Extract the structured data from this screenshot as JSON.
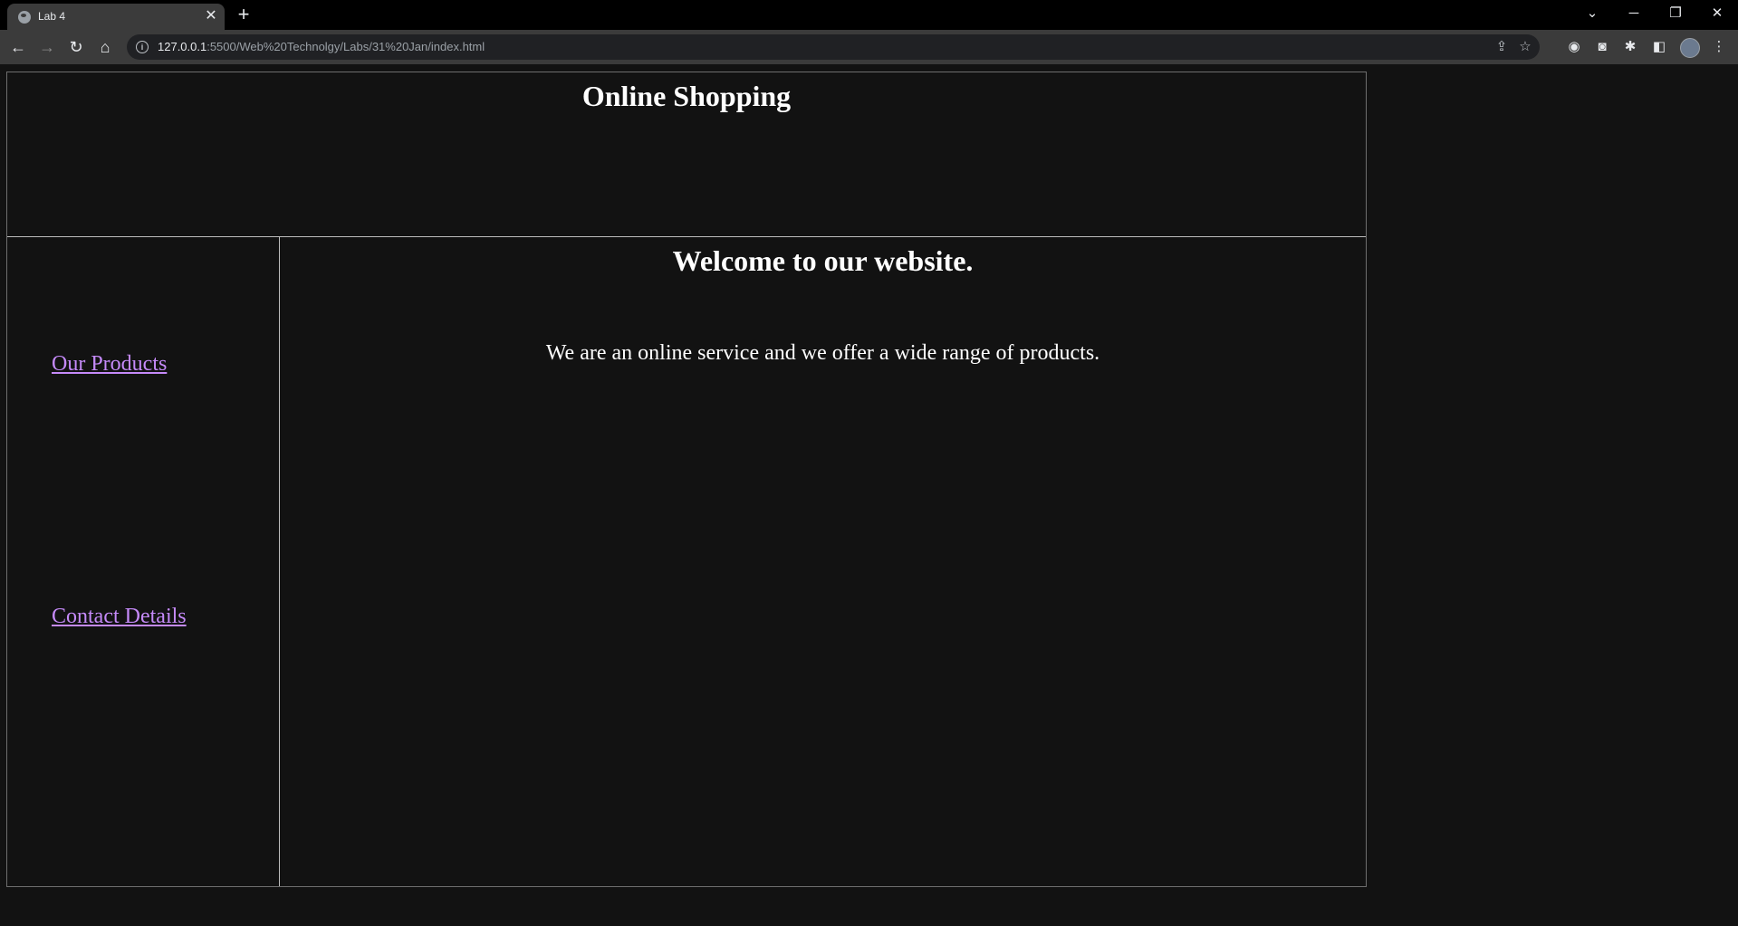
{
  "browser": {
    "tab": {
      "title": "Lab 4",
      "close": "✕"
    },
    "new_tab": "+",
    "window": {
      "tab_search": "⌄",
      "minimize": "─",
      "restore": "❐",
      "close": "✕"
    },
    "nav": {
      "back": "←",
      "forward": "→",
      "reload": "↻",
      "home": "⌂"
    },
    "url": {
      "host": "127.0.0.1",
      "rest": ":5500/Web%20Technolgy/Labs/31%20Jan/index.html"
    }
  },
  "page": {
    "title": "Online Shopping",
    "sidebar": {
      "links": [
        {
          "label": "Our Products"
        },
        {
          "label": "Contact Details"
        }
      ]
    },
    "main": {
      "heading": "Welcome to our website.",
      "text": "We are an online service and we offer a wide range of products."
    }
  },
  "colors": {
    "background": "#121212",
    "link": "#c58af9",
    "text": "#ffffff",
    "border": "#bdbdbd"
  }
}
